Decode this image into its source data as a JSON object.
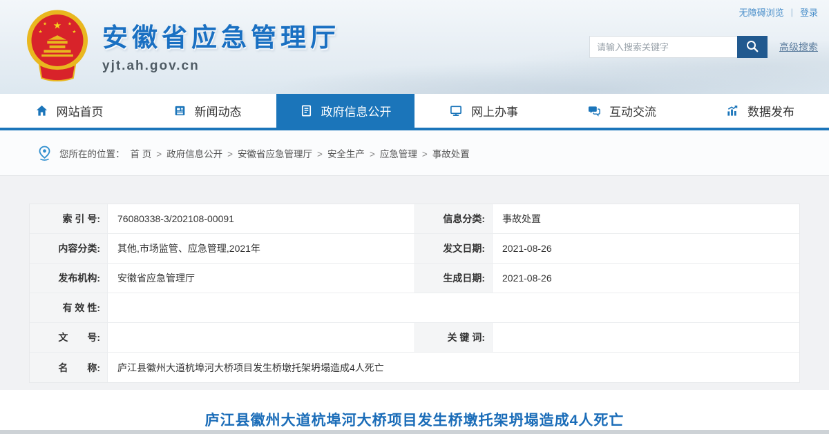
{
  "colors": {
    "accent_blue": "#1b75ba",
    "search_button_blue": "#21598f",
    "site_title_blue": "#1a70c2",
    "article_title_blue": "#1a6cb8",
    "emblem_red": "#d8232a",
    "emblem_gold": "#f0c41e"
  },
  "header": {
    "top_links": [
      {
        "key": "accessibility",
        "label": "无障碍浏览"
      },
      {
        "key": "login",
        "label": "登录"
      }
    ],
    "top_links_separator": "|",
    "site_title": "安徽省应急管理厅",
    "site_url": "yjt.ah.gov.cn",
    "search": {
      "placeholder": "请输入搜索关键字",
      "advanced_label": "高级搜索"
    }
  },
  "nav": {
    "items": [
      {
        "key": "home",
        "label": "网站首页",
        "icon": "home-icon",
        "active": false
      },
      {
        "key": "news",
        "label": "新闻动态",
        "icon": "news-icon",
        "active": false
      },
      {
        "key": "gov-info",
        "label": "政府信息公开",
        "icon": "document-icon",
        "active": true
      },
      {
        "key": "online-services",
        "label": "网上办事",
        "icon": "monitor-icon",
        "active": false
      },
      {
        "key": "interaction",
        "label": "互动交流",
        "icon": "chat-icon",
        "active": false
      },
      {
        "key": "data-release",
        "label": "数据发布",
        "icon": "chart-icon",
        "active": false
      }
    ]
  },
  "breadcrumb": {
    "prefix": "您所在的位置：",
    "separator": ">",
    "items": [
      "首 页",
      "政府信息公开",
      "安徽省应急管理厅",
      "安全生产",
      "应急管理",
      "事故处置"
    ]
  },
  "info_table": {
    "rows": [
      {
        "full": false,
        "cells": [
          {
            "label": "索 引 号:",
            "value": "76080338-3/202108-00091"
          },
          {
            "label": "信息分类:",
            "value": "事故处置"
          }
        ]
      },
      {
        "full": false,
        "cells": [
          {
            "label": "内容分类:",
            "value": "其他,市场监管、应急管理,2021年"
          },
          {
            "label": "发文日期:",
            "value": "2021-08-26"
          }
        ]
      },
      {
        "full": false,
        "cells": [
          {
            "label": "发布机构:",
            "value": "安徽省应急管理厅"
          },
          {
            "label": "生成日期:",
            "value": "2021-08-26"
          }
        ]
      },
      {
        "full": true,
        "cells": [
          {
            "label": "有 效 性:",
            "value": ""
          }
        ]
      },
      {
        "full": false,
        "cells": [
          {
            "label": "文　　号:",
            "value": ""
          },
          {
            "label": "关 键 词:",
            "value": ""
          }
        ]
      },
      {
        "full": true,
        "cells": [
          {
            "label": "名　　称:",
            "value": "庐江县徽州大道杭埠河大桥项目发生桥墩托架坍塌造成4人死亡"
          }
        ]
      }
    ]
  },
  "article": {
    "title": "庐江县徽州大道杭埠河大桥项目发生桥墩托架坍塌造成4人死亡"
  }
}
